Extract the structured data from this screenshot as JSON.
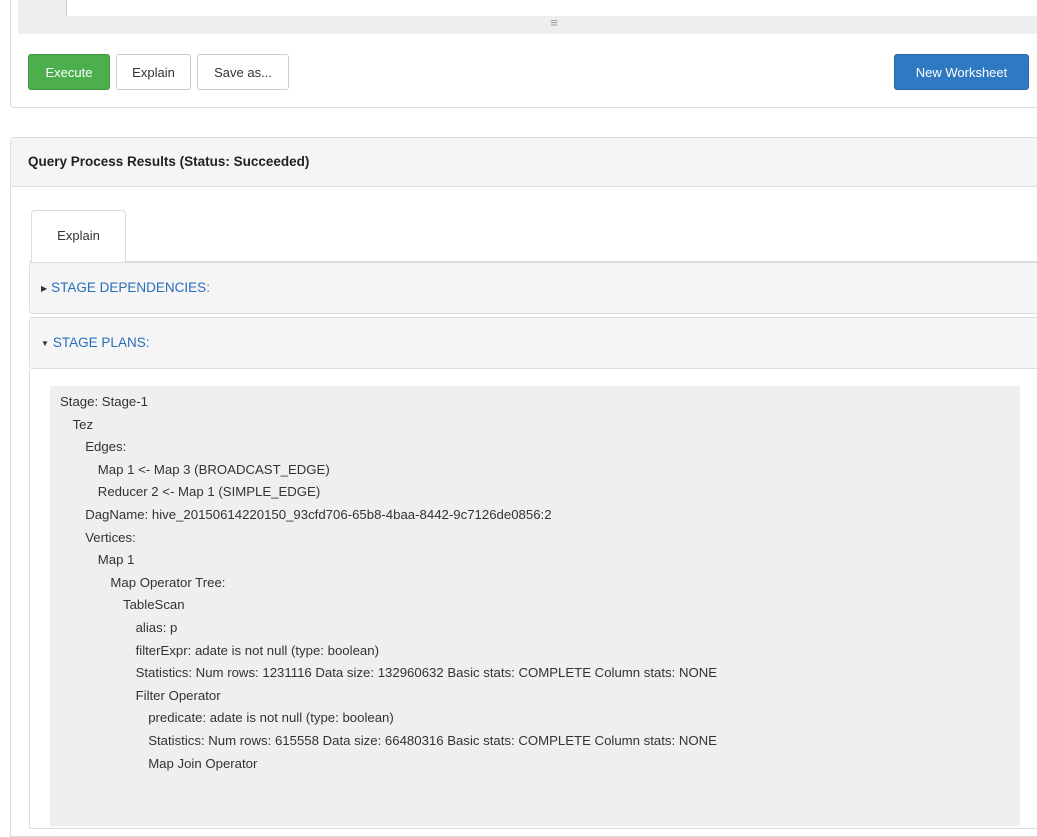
{
  "toolbar": {
    "execute_label": "Execute",
    "explain_label": "Explain",
    "saveas_label": "Save as...",
    "new_worksheet_label": "New Worksheet"
  },
  "editor": {
    "resize_glyph": "≡"
  },
  "results": {
    "heading": "Query Process Results (Status: Succeeded)",
    "tab_label": "Explain",
    "sections": [
      {
        "label": "STAGE DEPENDENCIES:",
        "arrow": "▶"
      },
      {
        "label": "STAGE PLANS:",
        "arrow": "▼"
      }
    ]
  },
  "plan": {
    "lines": [
      {
        "indent": 0,
        "text": "Stage: Stage-1"
      },
      {
        "indent": 1,
        "text": "Tez"
      },
      {
        "indent": 2,
        "text": "Edges:"
      },
      {
        "indent": 3,
        "text": "Map 1 <- Map 3 (BROADCAST_EDGE)"
      },
      {
        "indent": 3,
        "text": "Reducer 2 <- Map 1 (SIMPLE_EDGE)"
      },
      {
        "indent": 2,
        "text": "DagName: hive_20150614220150_93cfd706-65b8-4baa-8442-9c7126de0856:2"
      },
      {
        "indent": 2,
        "text": "Vertices:"
      },
      {
        "indent": 3,
        "text": "Map 1"
      },
      {
        "indent": 4,
        "text": "Map Operator Tree:"
      },
      {
        "indent": 5,
        "text": "TableScan"
      },
      {
        "indent": 6,
        "text": "alias: p"
      },
      {
        "indent": 6,
        "text": "filterExpr: adate is not null (type: boolean)"
      },
      {
        "indent": 6,
        "text": "Statistics: Num rows: 1231116 Data size: 132960632 Basic stats: COMPLETE Column stats: NONE"
      },
      {
        "indent": 6,
        "text": "Filter Operator"
      },
      {
        "indent": 7,
        "text": "predicate: adate is not null (type: boolean)"
      },
      {
        "indent": 7,
        "text": "Statistics: Num rows: 615558 Data size: 66480316 Basic stats: COMPLETE Column stats: NONE"
      },
      {
        "indent": 7,
        "text": "Map Join Operator"
      }
    ]
  }
}
